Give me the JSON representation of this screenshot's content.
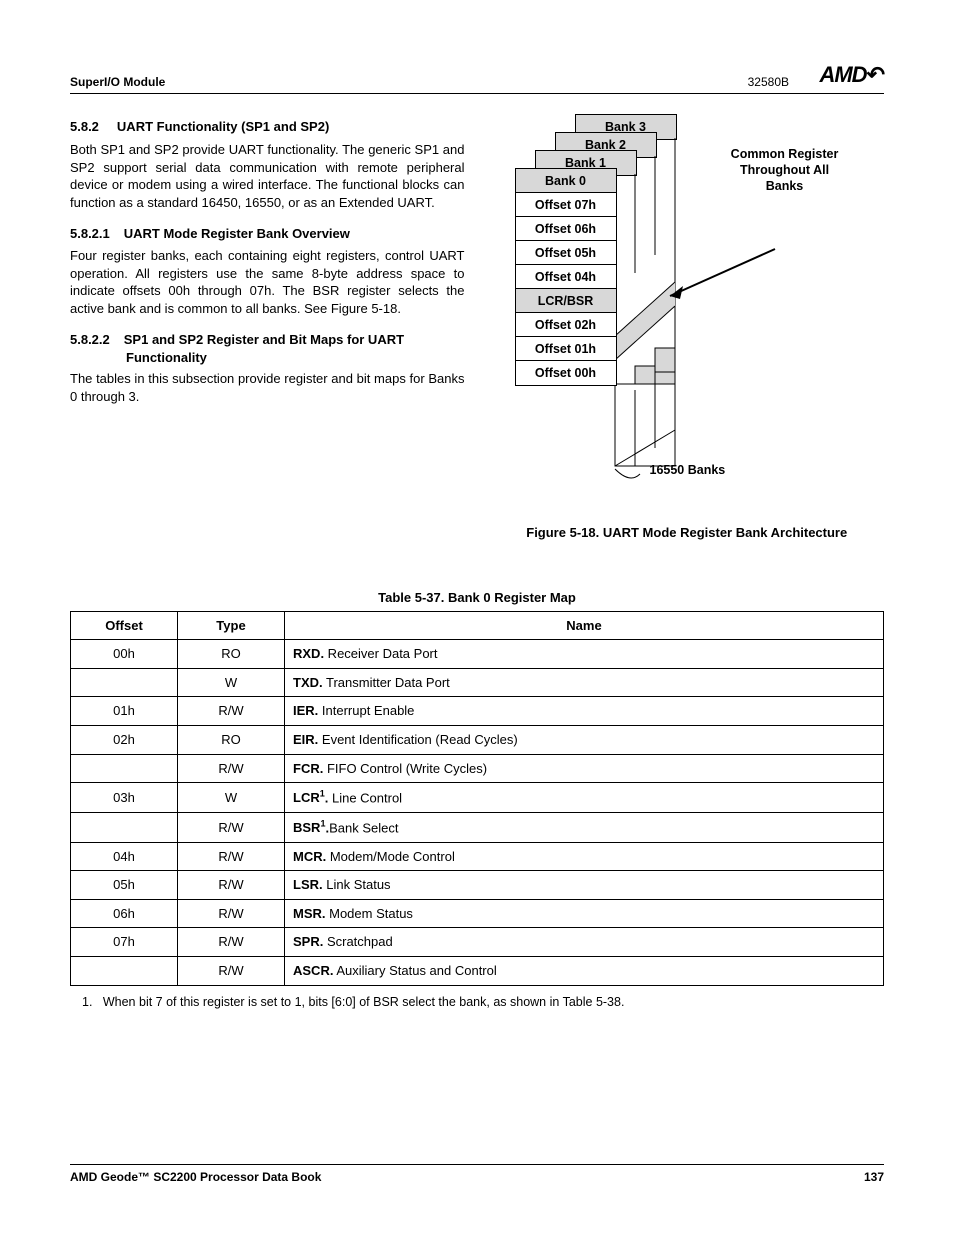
{
  "header": {
    "module": "SuperI/O Module",
    "docnum": "32580B",
    "logo": "AMD"
  },
  "section": {
    "num": "5.8.2",
    "title": "UART Functionality (SP1 and SP2)",
    "para1": "Both SP1 and SP2 provide UART functionality. The generic SP1 and SP2 support serial data communication with remote peripheral device or modem using a wired interface. The functional blocks can function as a standard 16450, 16550, or as an Extended UART."
  },
  "sub1": {
    "num": "5.8.2.1",
    "title": "UART Mode Register Bank Overview",
    "para": "Four register banks, each containing eight registers, control UART operation. All registers use the same 8-byte address space to indicate offsets 00h through 07h. The BSR register selects the active bank and is common to all banks. See Figure 5-18."
  },
  "sub2": {
    "num": "5.8.2.2",
    "title": "SP1 and SP2 Register and Bit Maps for UART Functionality",
    "para": "The tables in this subsection provide register and bit maps for Banks 0 through 3."
  },
  "diagram": {
    "bank3": "Bank 3",
    "bank2": "Bank 2",
    "bank1": "Bank 1",
    "bank0": "Bank 0",
    "off07": "Offset 07h",
    "off06": "Offset 06h",
    "off05": "Offset 05h",
    "off04": "Offset 04h",
    "lcrbsr": "LCR/BSR",
    "off02": "Offset 02h",
    "off01": "Offset 01h",
    "off00": "Offset 00h",
    "common": "Common Register Throughout All Banks",
    "bottom": "16550 Banks",
    "caption": "Figure 5-18.  UART Mode Register Bank Architecture"
  },
  "table": {
    "caption": "Table 5-37.  Bank 0 Register Map",
    "head": {
      "c1": "Offset",
      "c2": "Type",
      "c3": "Name"
    },
    "rows": [
      {
        "offset": "00h",
        "type": "RO",
        "bold": "RXD.",
        "rest": " Receiver Data Port"
      },
      {
        "offset": "",
        "type": "W",
        "bold": "TXD.",
        "rest": " Transmitter Data Port"
      },
      {
        "offset": "01h",
        "type": "R/W",
        "bold": "IER.",
        "rest": " Interrupt Enable"
      },
      {
        "offset": "02h",
        "type": "RO",
        "bold": "EIR.",
        "rest": " Event Identification (Read Cycles)"
      },
      {
        "offset": "",
        "type": "R/W",
        "bold": "FCR.",
        "rest": " FIFO Control (Write Cycles)"
      },
      {
        "offset": "03h",
        "type": "W",
        "bold": "LCR",
        "sup": "1",
        "boldend": ".",
        "rest": " Line Control"
      },
      {
        "offset": "",
        "type": "R/W",
        "bold": "BSR",
        "sup": "1",
        "boldend": ".",
        "rest": "Bank Select"
      },
      {
        "offset": "04h",
        "type": "R/W",
        "bold": "MCR.",
        "rest": " Modem/Mode Control"
      },
      {
        "offset": "05h",
        "type": "R/W",
        "bold": "LSR.",
        "rest": " Link Status"
      },
      {
        "offset": "06h",
        "type": "R/W",
        "bold": "MSR.",
        "rest": " Modem Status"
      },
      {
        "offset": "07h",
        "type": "R/W",
        "bold": "SPR.",
        "rest": " Scratchpad"
      },
      {
        "offset": "",
        "type": "R/W",
        "bold": "ASCR.",
        "rest": " Auxiliary Status and Control"
      }
    ],
    "footnote_num": "1.",
    "footnote": "When bit 7 of this register is set to 1, bits [6:0] of BSR select the bank, as shown in Table 5-38."
  },
  "footer": {
    "left": "AMD Geode™ SC2200  Processor Data Book",
    "right": "137"
  }
}
